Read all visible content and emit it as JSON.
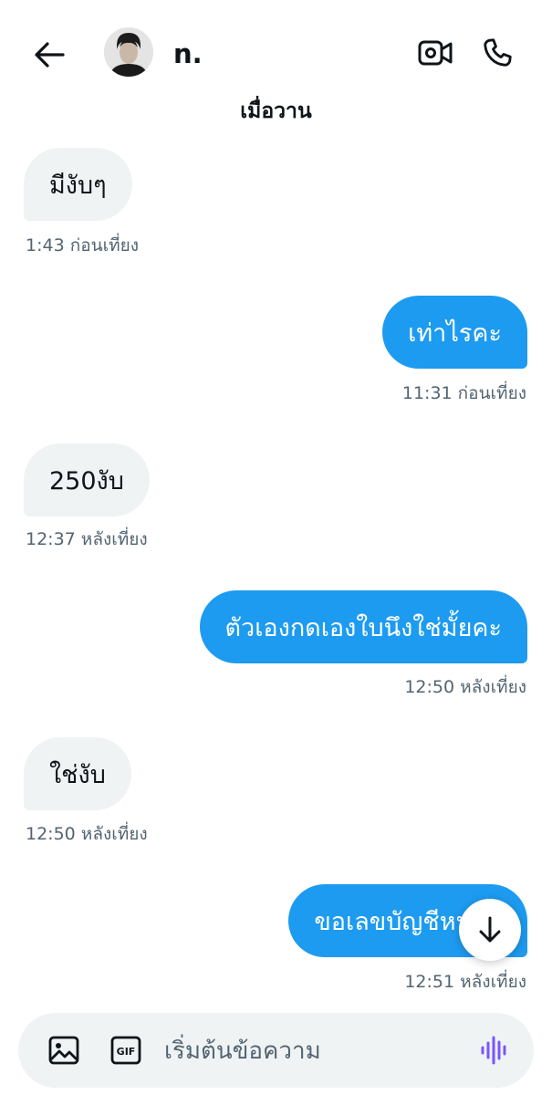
{
  "header": {
    "contact_name": "n.",
    "icons": {
      "back": "arrow-left-icon",
      "video": "video-camera-icon",
      "call": "phone-icon"
    }
  },
  "date_separator": "เมื่อวาน",
  "messages": [
    {
      "direction": "received",
      "text": "มีงับๆ",
      "time": "1:43 ก่อนเที่ยง"
    },
    {
      "direction": "sent",
      "text": "เท่าไรคะ",
      "time": "11:31 ก่อนเที่ยง"
    },
    {
      "direction": "received",
      "text": "250งับ",
      "time": "12:37 หลังเที่ยง"
    },
    {
      "direction": "sent",
      "text": "ตัวเองกดเองใบนึงใช่มั้ยคะ",
      "time": "12:50 หลังเที่ยง"
    },
    {
      "direction": "received",
      "text": "ใช่งับ",
      "time": "12:50 หลังเที่ยง"
    },
    {
      "direction": "sent",
      "text": "ขอเลขบัญชีหน่อย",
      "time": "12:51 หลังเที่ยง"
    }
  ],
  "composer": {
    "placeholder": "เริ่มต้นข้อความ",
    "gif_label": "GIF"
  },
  "colors": {
    "accent": "#1d9bf0",
    "received_bubble": "#eff3f4",
    "voice": "#7856ff"
  }
}
